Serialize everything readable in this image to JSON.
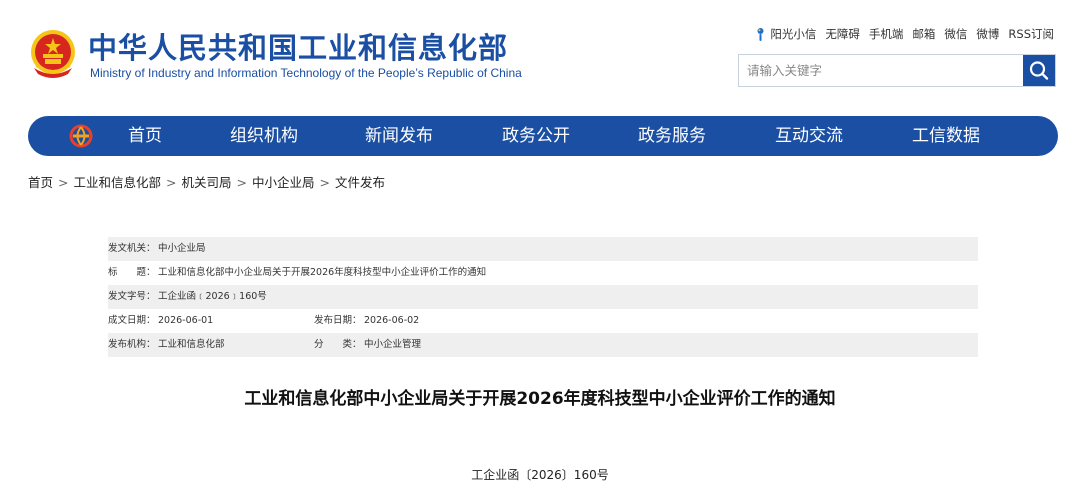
{
  "header": {
    "title": "中华人民共和国工业和信息化部",
    "subtitle": "Ministry of Industry and Information Technology of the People’s Republic of China",
    "top_links": [
      "阳光小信",
      "无障碍",
      "手机端",
      "邮箱",
      "微信",
      "微博",
      "RSS订阅"
    ],
    "search_placeholder": "请输入关键字"
  },
  "nav": {
    "items": [
      "首页",
      "组织机构",
      "新闻发布",
      "政务公开",
      "政务服务",
      "互动交流",
      "工信数据"
    ]
  },
  "breadcrumb": [
    "首页",
    "工业和信息化部",
    "机关司局",
    "中小企业局",
    "文件发布"
  ],
  "info": {
    "issuer_label": "发文机关：",
    "issuer": "中小企业局",
    "title_label": "标　　题：",
    "title": "工业和信息化部中小企业局关于开展2026年度科技型中小企业评价工作的通知",
    "docno_label": "发文字号：",
    "docno": "工企业函﹝2026﹞160号",
    "created_label": "成文日期：",
    "created": "2026-06-01",
    "published_label": "发布日期：",
    "published": "2026-06-02",
    "org_label": "发布机构：",
    "org": "工业和信息化部",
    "category_label": "分　　类：",
    "category": "中小企业管理"
  },
  "document": {
    "title": "工业和信息化部中小企业局关于开展2026年度科技型中小企业评价工作的通知",
    "number": "工企业函〔2026〕160号"
  },
  "colors": {
    "brand_blue": "#1a4fa3",
    "emblem_red": "#d7261f",
    "emblem_gold": "#f5c518"
  }
}
